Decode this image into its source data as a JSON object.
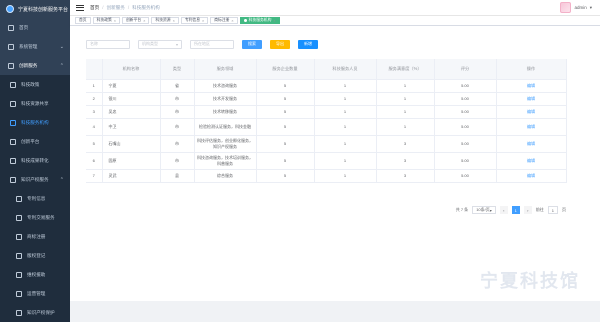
{
  "app": {
    "title": "宁夏科技创新服务平台"
  },
  "sidebar": {
    "items": [
      {
        "label": "首页",
        "level": 0
      },
      {
        "label": "系统管理",
        "level": 0,
        "arrow": "⌄"
      },
      {
        "label": "创新服务",
        "level": 0,
        "arrow": "⌃",
        "open": true
      },
      {
        "label": "科技政策",
        "level": 1
      },
      {
        "label": "科技资源共享",
        "level": 1
      },
      {
        "label": "科技服务机构",
        "level": 1,
        "active": true
      },
      {
        "label": "创新平台",
        "level": 1
      },
      {
        "label": "科技成果转化",
        "level": 1
      },
      {
        "label": "知识产权服务",
        "level": 1,
        "arrow": "⌃"
      },
      {
        "label": "专利信息",
        "level": 2
      },
      {
        "label": "专利交易服务",
        "level": 2
      },
      {
        "label": "商标注册",
        "level": 2
      },
      {
        "label": "版权登记",
        "level": 2
      },
      {
        "label": "维权援助",
        "level": 2
      },
      {
        "label": "运营管理",
        "level": 2
      },
      {
        "label": "知识产权保护",
        "level": 2
      }
    ]
  },
  "navbar": {
    "breadcrumb": [
      "首页",
      "创新服务",
      "科技服务机构"
    ],
    "username": "admin"
  },
  "tags": [
    {
      "label": "首页",
      "closable": false
    },
    {
      "label": "科技政策",
      "closable": true
    },
    {
      "label": "创新平台",
      "closable": true
    },
    {
      "label": "科技资源",
      "closable": true
    },
    {
      "label": "专利信息",
      "closable": true
    },
    {
      "label": "商标注册",
      "closable": true
    },
    {
      "label": "科技服务机构",
      "closable": true,
      "active": true
    }
  ],
  "search": {
    "name_placeholder": "名称",
    "type_placeholder": "机构类型",
    "region_placeholder": "所在地区",
    "search_label": "搜索",
    "export_label": "导出",
    "add_label": "新增"
  },
  "table": {
    "headers": [
      "机构名称",
      "类型",
      "服务领域",
      "服务企业数量",
      "科技服务人员",
      "服务满意度（%）",
      "评分",
      "操作"
    ],
    "rows": [
      {
        "idx": "1",
        "name": "宁夏",
        "type": "省",
        "field": "技术咨询服务",
        "c1": "5",
        "c2": "1",
        "c3": "1",
        "score": "5.00",
        "op": "编辑"
      },
      {
        "idx": "2",
        "name": "银川",
        "type": "市",
        "field": "技术开发服务",
        "c1": "5",
        "c2": "1",
        "c3": "1",
        "score": "5.00",
        "op": "编辑"
      },
      {
        "idx": "3",
        "name": "吴忠",
        "type": "市",
        "field": "技术转移服务",
        "c1": "5",
        "c2": "1",
        "c3": "1",
        "score": "5.00",
        "op": "编辑"
      },
      {
        "idx": "4",
        "name": "中卫",
        "type": "市",
        "field": "检验检测认证服务，科技金融",
        "c1": "5",
        "c2": "1",
        "c3": "1",
        "score": "5.00",
        "op": "编辑",
        "tall": true
      },
      {
        "idx": "5",
        "name": "石嘴山",
        "type": "市",
        "field": "科技评估服务，创业孵化服务，知识产权服务",
        "c1": "5",
        "c2": "1",
        "c3": "3",
        "score": "5.00",
        "op": "编辑",
        "tall": true,
        "group": true
      },
      {
        "idx": "6",
        "name": "固原",
        "type": "市",
        "field": "科技咨询服务，技术培训服务，科普服务",
        "c1": "5",
        "c2": "1",
        "c3": "3",
        "score": "5.00",
        "op": "编辑",
        "tall": true
      },
      {
        "idx": "7",
        "name": "灵武",
        "type": "县",
        "field": "综合服务",
        "c1": "5",
        "c2": "1",
        "c3": "3",
        "score": "5.00",
        "op": "编辑"
      }
    ]
  },
  "pagination": {
    "total": "共 7 条",
    "page_size": "10条/页",
    "prev": "‹",
    "current": "1",
    "next": "›",
    "goto_label": "前往",
    "goto_value": "1",
    "goto_suffix": "页"
  },
  "watermark": "宁夏科技馆",
  "colors": {
    "sidebar_bg": "#304156",
    "accent": "#409eff",
    "tag_active": "#42b983",
    "export": "#ffba00"
  }
}
